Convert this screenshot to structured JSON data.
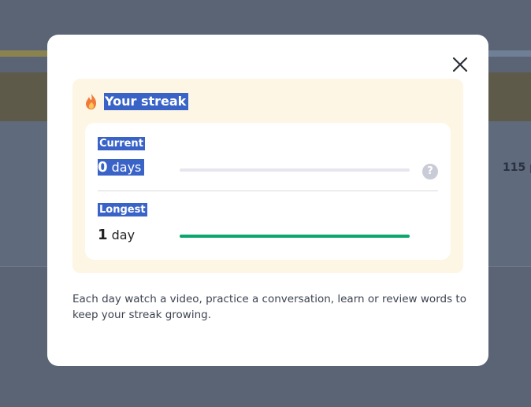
{
  "background": {
    "count_text": "115 p"
  },
  "modal": {
    "close_icon": "close-icon",
    "streak": {
      "icon": "flame-icon",
      "title": "Your streak",
      "current": {
        "label": "Current",
        "number": "0",
        "unit": "days",
        "progress": 0,
        "help_icon": "question-icon",
        "help_glyph": "?"
      },
      "longest": {
        "label": "Longest",
        "number": "1",
        "unit": "day",
        "progress": 1.0
      }
    },
    "help_text": "Each day watch a video, practice a conversation, learn or review words to keep your streak growing."
  },
  "colors": {
    "highlight": "#3a63c7",
    "progress_fill": "#0aa66e",
    "progress_track": "#e6e6ee",
    "streak_card_bg": "#fef6e4",
    "flame": "#f07a3a"
  }
}
